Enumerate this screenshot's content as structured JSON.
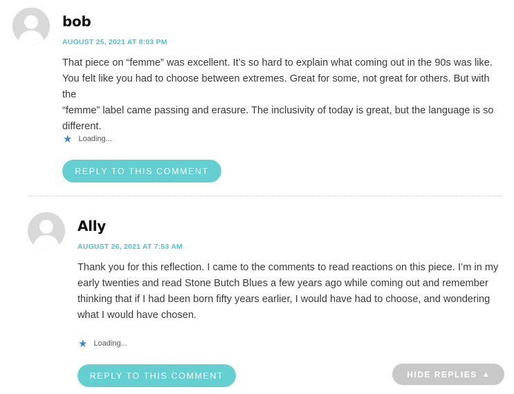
{
  "comments": [
    {
      "author": "bob",
      "date": "AUGUST 25, 2021 AT 8:03 PM",
      "paragraph_lines": [
        "That piece on “femme” was excellent. It’s so hard to explain what coming out in the 90s was like.",
        "You felt like you had to choose between extremes. Great for some, not great for others. But with the",
        "“femme” label came passing and erasure. The inclusivity of today is great, but the language is so",
        "different."
      ],
      "like_status": "Loading...",
      "like_icon": "star-icon",
      "reply_label": "REPLY TO THIS COMMENT"
    },
    {
      "author": "Ally",
      "date": "AUGUST 26, 2021 AT 7:53 AM",
      "paragraph_lines": [
        "Thank you for this reflection. I came to the comments to read reactions on this piece. I’m in my",
        "early twenties and read Stone Butch Blues a few years ago while coming out and remember",
        "thinking that if I had been born fifty years earlier, I would have had to choose, and wondering",
        "what I would have chosen."
      ],
      "like_status": "Loading...",
      "like_icon": "star-icon",
      "reply_label": "REPLY TO THIS COMMENT"
    }
  ],
  "hide_replies": {
    "label": "HIDE REPLIES",
    "icon": "caret-up-icon",
    "glyph": "▲"
  },
  "colors": {
    "accent": "#4fc3d1",
    "button": "#63cfd0",
    "hide_button": "#c8c8c8",
    "star": "#2f8fcc"
  }
}
